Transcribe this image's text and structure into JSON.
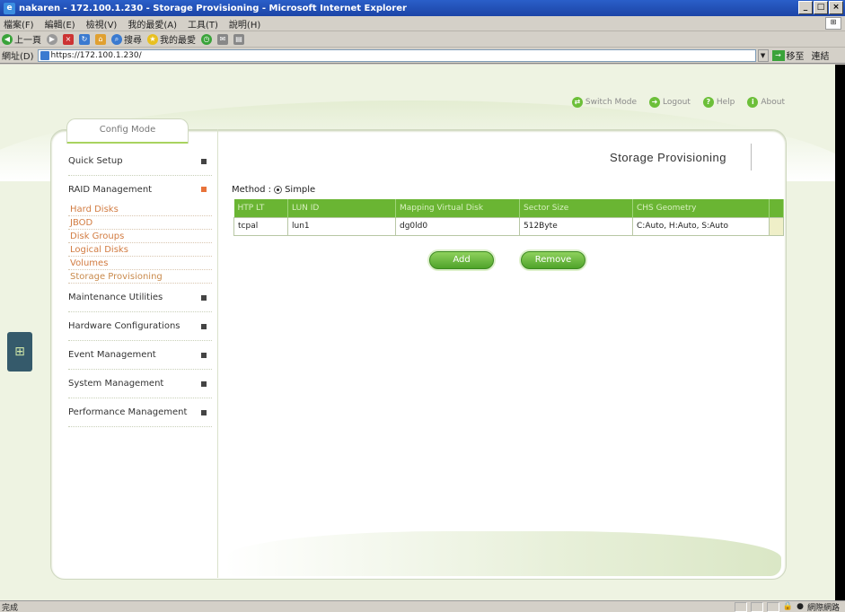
{
  "browser": {
    "title": "nakaren - 172.100.1.230 - Storage Provisioning - Microsoft Internet Explorer",
    "menu": [
      "檔案(F)",
      "編輯(E)",
      "檢視(V)",
      "我的最愛(A)",
      "工具(T)",
      "說明(H)"
    ],
    "toolbar": {
      "back": "上一頁",
      "search": "搜尋",
      "favorites": "我的最愛"
    },
    "address_label": "網址(D)",
    "address": "https://172.100.1.230/",
    "go_label": "移至",
    "links_label": "連結",
    "status_left": "完成",
    "status_right": "網際網路"
  },
  "top_links": [
    {
      "label": "Switch Mode",
      "icon": "switch-icon"
    },
    {
      "label": "Logout",
      "icon": "logout-icon"
    },
    {
      "label": "Help",
      "icon": "help-icon"
    },
    {
      "label": "About",
      "icon": "about-icon"
    }
  ],
  "config_tab": "Config Mode",
  "sidebar": {
    "groups": [
      {
        "label": "Quick Setup"
      },
      {
        "label": "RAID Management"
      },
      {
        "label": "Maintenance Utilities"
      },
      {
        "label": "Hardware Configurations"
      },
      {
        "label": "Event Management"
      },
      {
        "label": "System Management"
      },
      {
        "label": "Performance Management"
      }
    ],
    "raid_items": [
      "Hard Disks",
      "JBOD",
      "Disk Groups",
      "Logical Disks",
      "Volumes",
      "Storage Provisioning"
    ]
  },
  "page_title": "Storage Provisioning",
  "method": {
    "label": "Method :",
    "option": "Simple"
  },
  "table": {
    "headers": [
      "HTP LT",
      "LUN ID",
      "Mapping Virtual Disk",
      "Sector Size",
      "CHS Geometry"
    ],
    "rows": [
      [
        "tcpal",
        "lun1",
        "dg0ld0",
        "512Byte",
        "C:Auto, H:Auto, S:Auto"
      ]
    ]
  },
  "buttons": {
    "add": "Add",
    "remove": "Remove"
  },
  "colors": {
    "accent_green": "#6ab533",
    "link_orange": "#d27c42",
    "bg_light_green": "#eef3e2"
  }
}
